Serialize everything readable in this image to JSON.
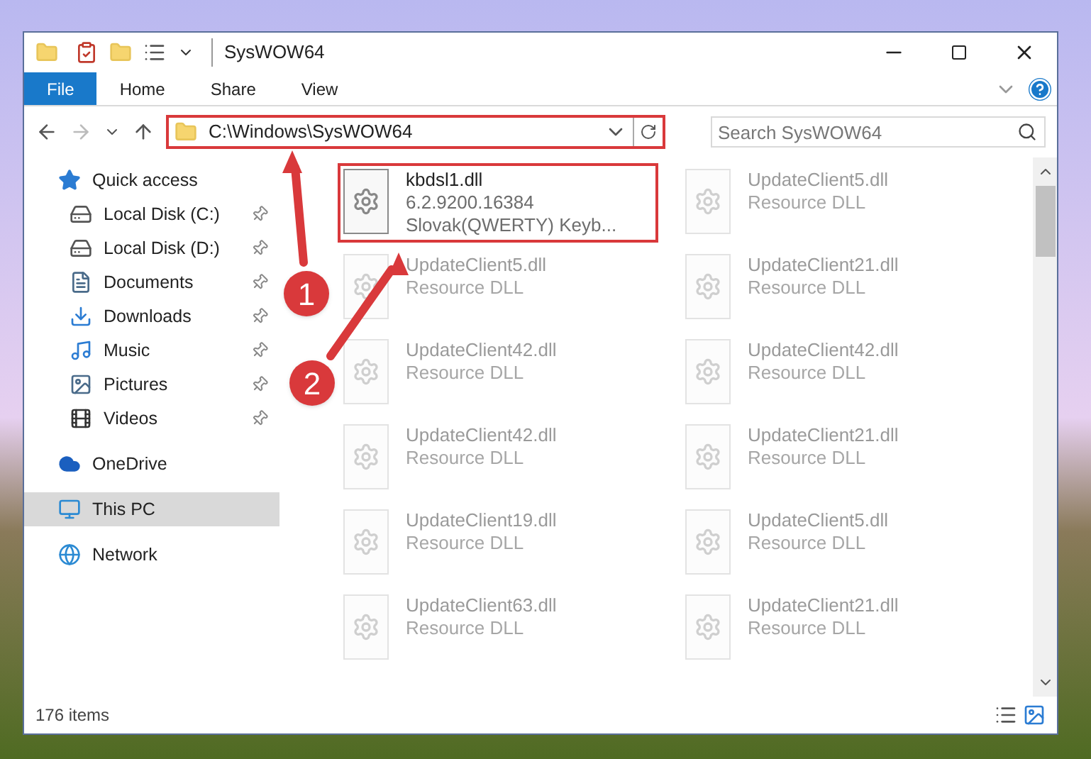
{
  "window": {
    "title": "SysWOW64"
  },
  "ribbon_tabs": [
    {
      "label": "File",
      "kind": "file",
      "selected": false
    },
    {
      "label": "Home",
      "kind": "tab",
      "selected": false
    },
    {
      "label": "Share",
      "kind": "tab",
      "selected": false
    },
    {
      "label": "View",
      "kind": "tab",
      "selected": false
    }
  ],
  "address_bar": {
    "value": "C:\\Windows\\SysWOW64",
    "highlighted": true
  },
  "search": {
    "placeholder": "Search SysWOW64"
  },
  "sidebar": {
    "items": [
      {
        "label": "Quick access",
        "kind": "star",
        "selected": false,
        "children": [
          {
            "label": "Local Disk (C:)",
            "kind": "disk",
            "pinned": true,
            "selected": false
          },
          {
            "label": "Local Disk (D:)",
            "kind": "disk",
            "pinned": true,
            "selected": false
          },
          {
            "label": "Documents",
            "kind": "documents",
            "pinned": true,
            "selected": false
          },
          {
            "label": "Downloads",
            "kind": "downloads",
            "pinned": true,
            "selected": false
          },
          {
            "label": "Music",
            "kind": "music",
            "pinned": true,
            "selected": false
          },
          {
            "label": "Pictures",
            "kind": "pictures",
            "pinned": true,
            "selected": false
          },
          {
            "label": "Videos",
            "kind": "videos",
            "pinned": true,
            "selected": false
          }
        ]
      },
      {
        "label": "OneDrive",
        "kind": "cloud",
        "selected": false
      },
      {
        "label": "This PC",
        "kind": "pc",
        "selected": true
      },
      {
        "label": "Network",
        "kind": "network",
        "selected": false
      }
    ]
  },
  "files": [
    {
      "name": "kbdsl1.dll",
      "details": [
        "6.2.9200.16384",
        "Slovak(QWERTY) Keyb..."
      ],
      "highlighted": true,
      "faded": false
    },
    {
      "name": "UpdateClient5.dll",
      "details": [
        "Resource DLL"
      ],
      "highlighted": false,
      "faded": true
    },
    {
      "name": "UpdateClient5.dll",
      "details": [
        "Resource DLL"
      ],
      "highlighted": false,
      "faded": true
    },
    {
      "name": "UpdateClient21.dll",
      "details": [
        "Resource DLL"
      ],
      "highlighted": false,
      "faded": true
    },
    {
      "name": "UpdateClient42.dll",
      "details": [
        "Resource DLL"
      ],
      "highlighted": false,
      "faded": true
    },
    {
      "name": "UpdateClient42.dll",
      "details": [
        "Resource DLL"
      ],
      "highlighted": false,
      "faded": true
    },
    {
      "name": "UpdateClient42.dll",
      "details": [
        "Resource DLL"
      ],
      "highlighted": false,
      "faded": true
    },
    {
      "name": "UpdateClient21.dll",
      "details": [
        "Resource DLL"
      ],
      "highlighted": false,
      "faded": true
    },
    {
      "name": "UpdateClient19.dll",
      "details": [
        "Resource DLL"
      ],
      "highlighted": false,
      "faded": true
    },
    {
      "name": "UpdateClient5.dll",
      "details": [
        "Resource DLL"
      ],
      "highlighted": false,
      "faded": true
    },
    {
      "name": "UpdateClient63.dll",
      "details": [
        "Resource DLL"
      ],
      "highlighted": false,
      "faded": true
    },
    {
      "name": "UpdateClient21.dll",
      "details": [
        "Resource DLL"
      ],
      "highlighted": false,
      "faded": true
    }
  ],
  "status_bar": {
    "count": "176 items"
  },
  "annotations": [
    {
      "label": "1"
    },
    {
      "label": "2"
    }
  ]
}
